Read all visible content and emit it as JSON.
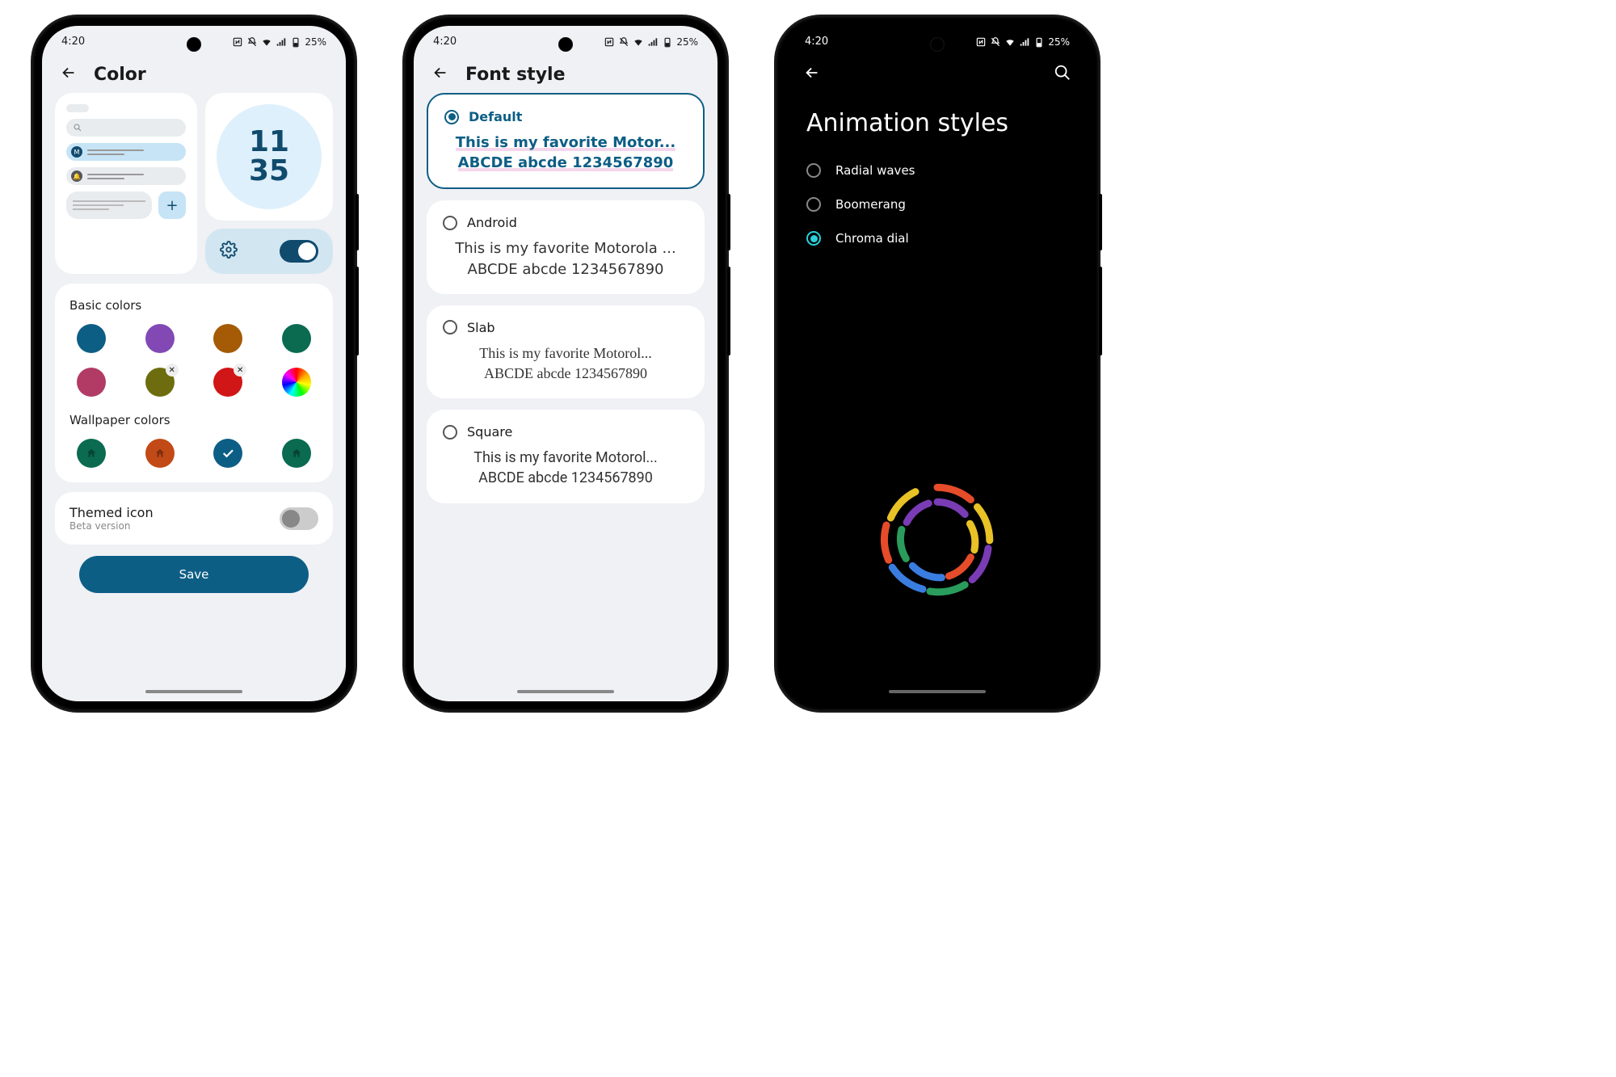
{
  "statusbar": {
    "time": "4:20",
    "battery": "25%"
  },
  "phone1": {
    "title": "Color",
    "clock": {
      "top": "11",
      "bottom": "35"
    },
    "basic_label": "Basic colors",
    "basic": [
      {
        "c": "#0d5e85"
      },
      {
        "c": "#8249b5"
      },
      {
        "c": "#a55a06"
      },
      {
        "c": "#0a6b51"
      },
      {
        "c": "#b23b65"
      },
      {
        "c": "#6d6d10",
        "x": true
      },
      {
        "c": "#d01616",
        "x": true
      },
      {
        "rainbow": true
      }
    ],
    "wallpaper_label": "Wallpaper colors",
    "wallpaper": [
      {
        "c": "#0a6b51",
        "home": true
      },
      {
        "c": "#c24a17",
        "home": true
      },
      {
        "c": "#0d5e85",
        "check": true
      },
      {
        "c": "#0a6b51",
        "home": true
      }
    ],
    "themed": {
      "label": "Themed icon",
      "sub": "Beta version"
    },
    "save": "Save"
  },
  "phone2": {
    "title": "Font style",
    "sample1": "This is my favorite Motor...",
    "sample1b": "ABCDE abcde 1234567890",
    "sample2": "This is my favorite Motorola ...",
    "sample2b": "ABCDE abcde 1234567890",
    "sample3": "This is my favorite Motorol...",
    "sample3b": "ABCDE abcde 1234567890",
    "sample4": "This is my favorite Motorol...",
    "sample4b": "ABCDE abcde 1234567890",
    "fonts": [
      "Default",
      "Android",
      "Slab",
      "Square"
    ]
  },
  "phone3": {
    "title": "Animation styles",
    "options": [
      "Radial waves",
      "Boomerang",
      "Chroma dial"
    ],
    "selected": 2
  }
}
